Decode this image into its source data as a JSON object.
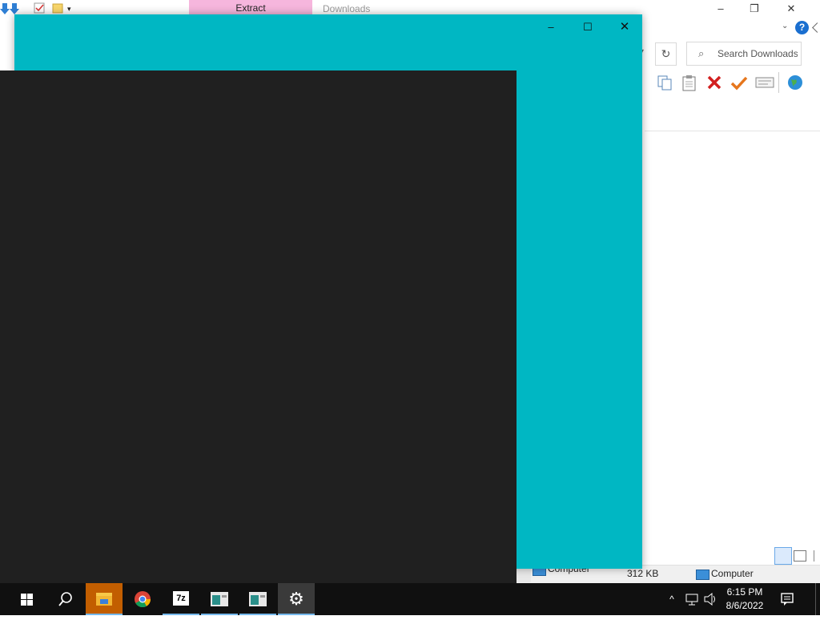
{
  "explorer": {
    "ribbon_tab": "Extract",
    "title": "Downloads",
    "minimize": "–",
    "restore": "❐",
    "close": "✕",
    "help": "?",
    "refresh": "↻",
    "search_placeholder": "Search Downloads",
    "status_size": "312 KB",
    "status_zone": "Computer",
    "status_zone2": "Computer"
  },
  "teal_window": {
    "minimize": "–",
    "maximize": "☐",
    "close": "✕"
  },
  "taskbar": {
    "apps": [
      {
        "name": "start",
        "label": "⊞"
      },
      {
        "name": "search",
        "label": "⌕"
      },
      {
        "name": "file-explorer",
        "label": ""
      },
      {
        "name": "chrome",
        "label": ""
      },
      {
        "name": "7zip",
        "label": "7z"
      },
      {
        "name": "app-a",
        "label": ""
      },
      {
        "name": "app-b",
        "label": ""
      },
      {
        "name": "settings",
        "label": "⚙"
      }
    ],
    "time": "6:15 PM",
    "date": "8/6/2022"
  },
  "colors": {
    "teal": "#00b7c3",
    "dark_panel": "#202020",
    "taskbar": "#101010",
    "extract_tab": "#f6b6dd",
    "explorer_active": "#c25e00"
  }
}
